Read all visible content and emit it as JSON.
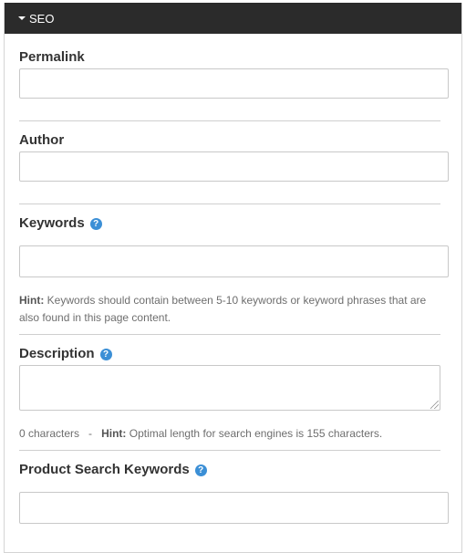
{
  "panel": {
    "title": "SEO",
    "fields": {
      "permalink": {
        "label": "Permalink",
        "value": ""
      },
      "author": {
        "label": "Author",
        "value": ""
      },
      "keywords": {
        "label": "Keywords",
        "value": "",
        "help_icon": "?",
        "hint_label": "Hint:",
        "hint_text": "Keywords should contain between 5-10 keywords or keyword phrases that are also found in this page content."
      },
      "description": {
        "label": "Description",
        "value": "",
        "help_icon": "?",
        "char_count": "0 characters",
        "separator": "-",
        "hint_label": "Hint:",
        "hint_text": "Optimal length for search engines is 155 characters."
      },
      "product_search_keywords": {
        "label": "Product Search Keywords",
        "value": "",
        "help_icon": "?"
      }
    }
  },
  "colors": {
    "header_bg": "#2b2b2b",
    "help_icon": "#3b8fd6",
    "border": "#c8c8c8"
  },
  "icons": {
    "caret": "caret-down-icon",
    "help": "question-circle-icon"
  }
}
